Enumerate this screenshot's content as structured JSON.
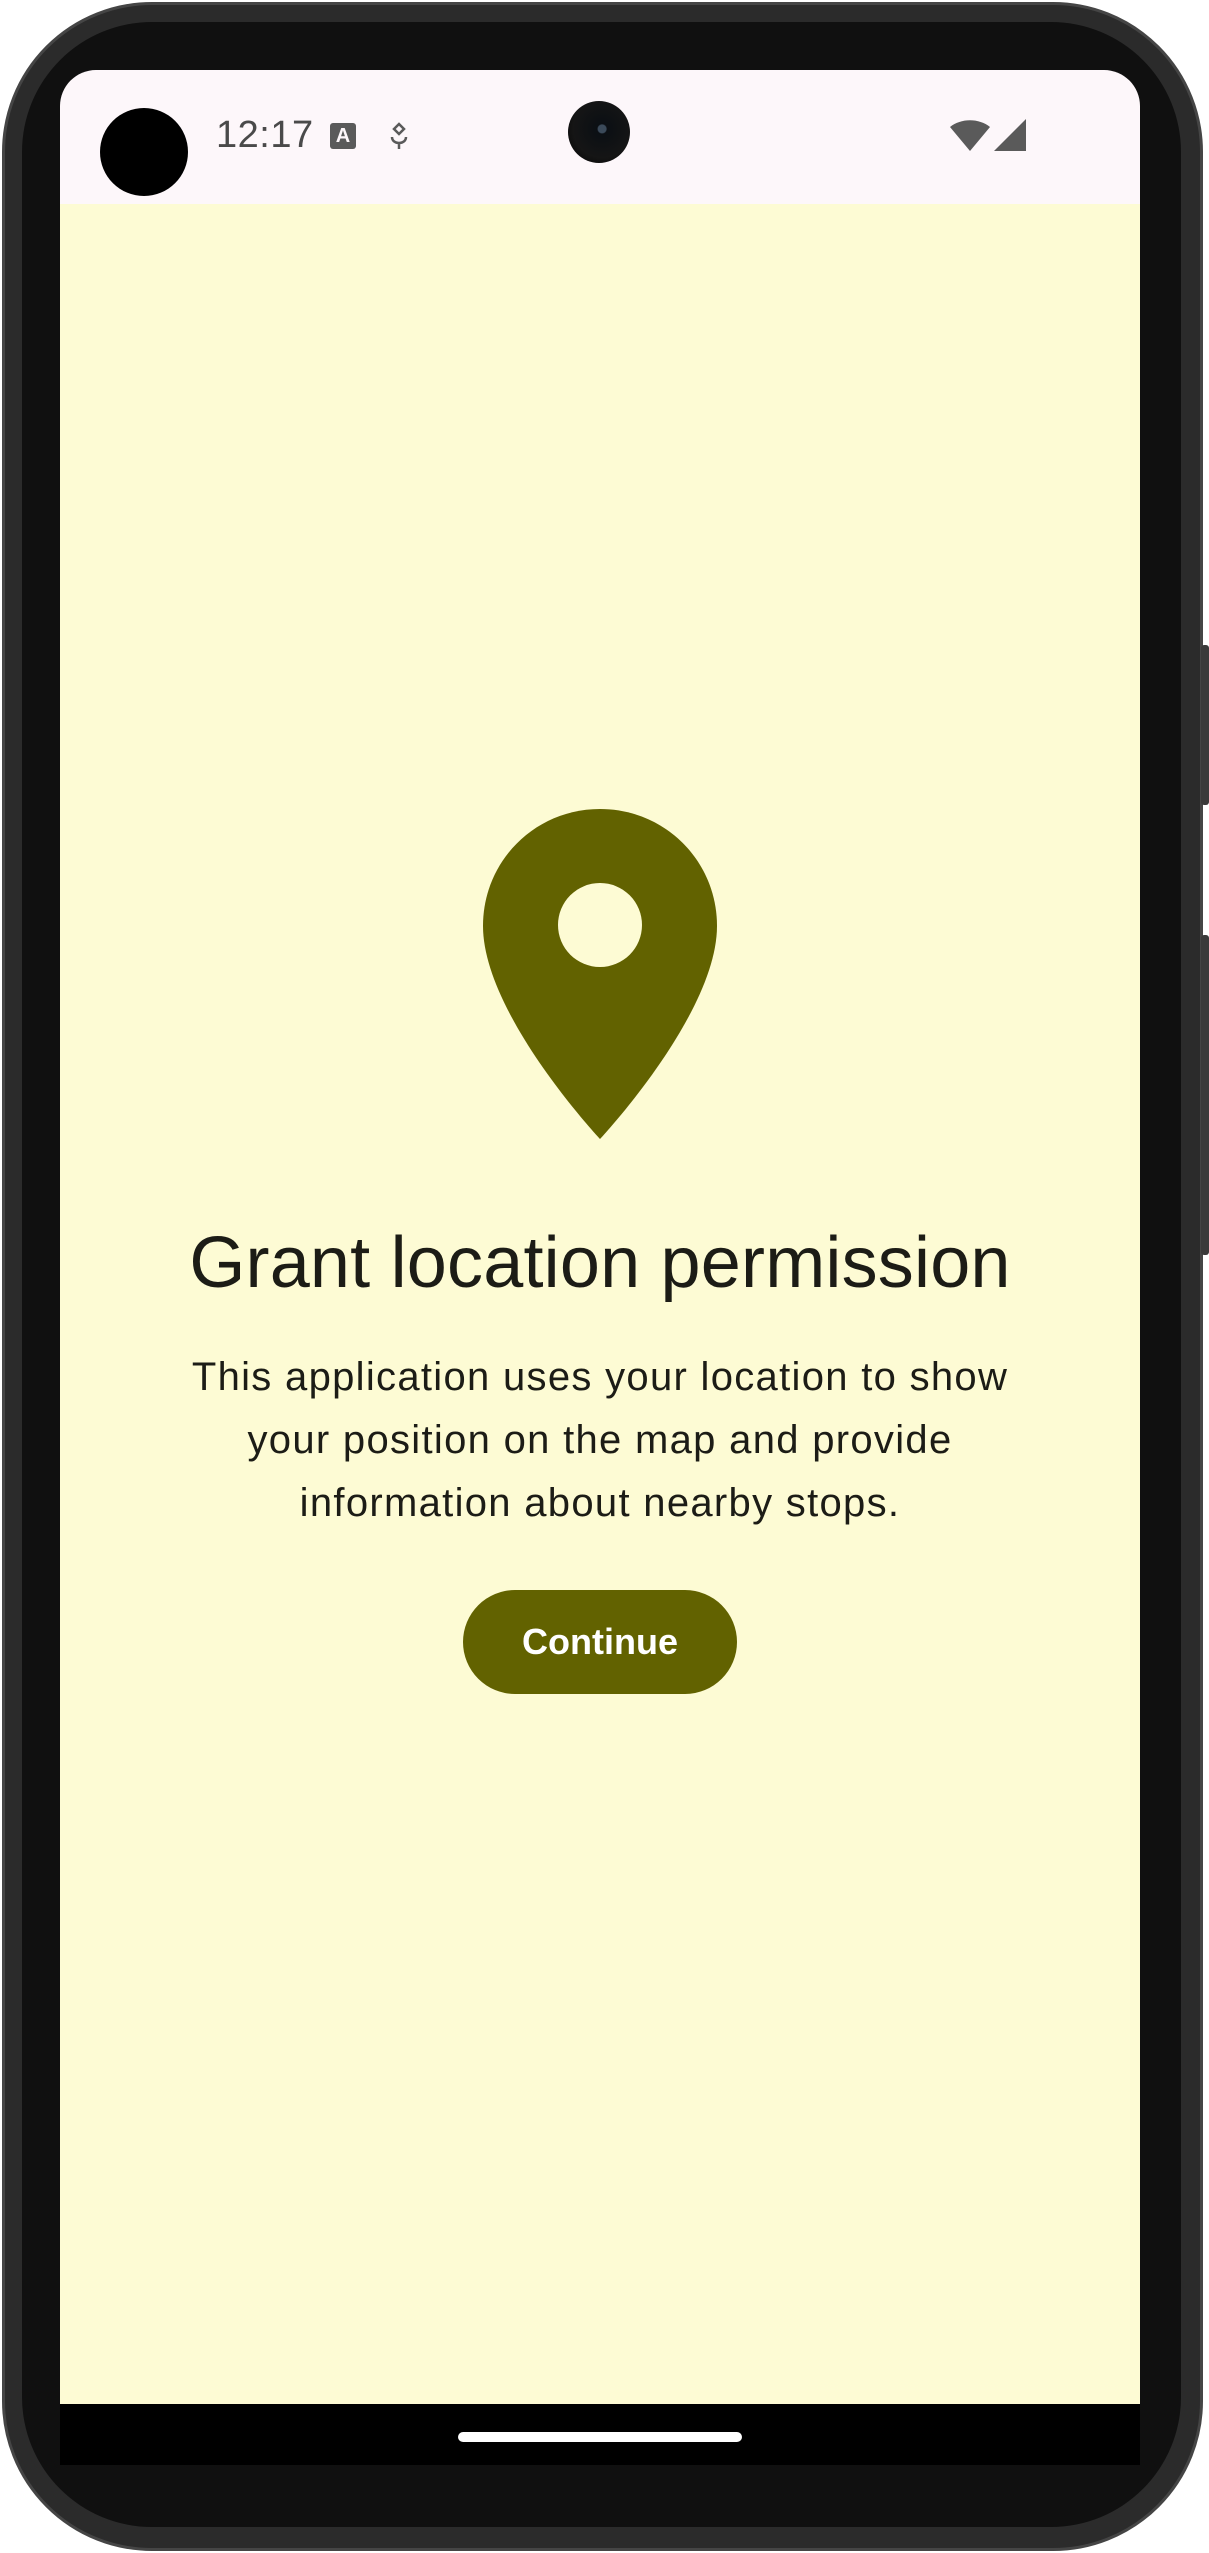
{
  "status_bar": {
    "time": "12:17",
    "icons": [
      "text-a-icon",
      "assistant-icon",
      "wifi-icon",
      "cell-signal-icon"
    ]
  },
  "permission_screen": {
    "icon": "location-pin-icon",
    "title": "Grant location permission",
    "description": "This application uses your location to show your position on the map and provide information about nearby stops.",
    "continue_label": "Continue"
  },
  "colors": {
    "background": "#fdfbd4",
    "accent": "#626200",
    "text": "#1c1c16",
    "status_bar": "#fdf7fa"
  }
}
